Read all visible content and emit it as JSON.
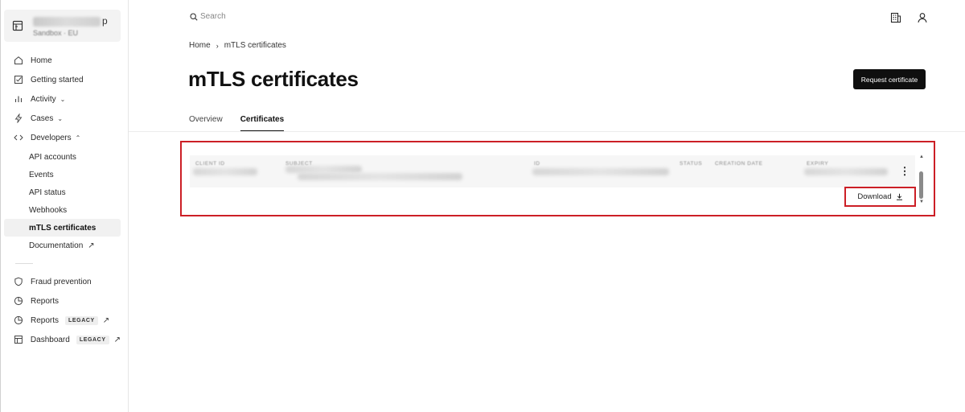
{
  "account": {
    "name_end": "p",
    "sub": "Sandbox · EU"
  },
  "search": {
    "placeholder": "Search"
  },
  "nav": {
    "home": "Home",
    "getting_started": "Getting started",
    "activity": "Activity",
    "cases": "Cases",
    "developers": "Developers",
    "developers_sub": [
      "API accounts",
      "Events",
      "API status",
      "Webhooks",
      "mTLS certificates",
      "Documentation"
    ],
    "fraud_prevention": "Fraud prevention",
    "reports": "Reports",
    "reports_legacy": "Reports",
    "dashboard_legacy": "Dashboard",
    "legacy_badge": "LEGACY"
  },
  "breadcrumb": {
    "home": "Home",
    "current": "mTLS certificates"
  },
  "page": {
    "title": "mTLS certificates",
    "request_button": "Request certificate"
  },
  "tabs": [
    "Overview",
    "Certificates"
  ],
  "table": {
    "columns": [
      "CLIENT ID",
      "SUBJECT",
      "ID",
      "STATUS",
      "CREATION DATE",
      "EXPIRY"
    ],
    "download_label": "Download"
  },
  "colors": {
    "highlight": "#cc1f26",
    "primary": "#0f0f0f"
  }
}
